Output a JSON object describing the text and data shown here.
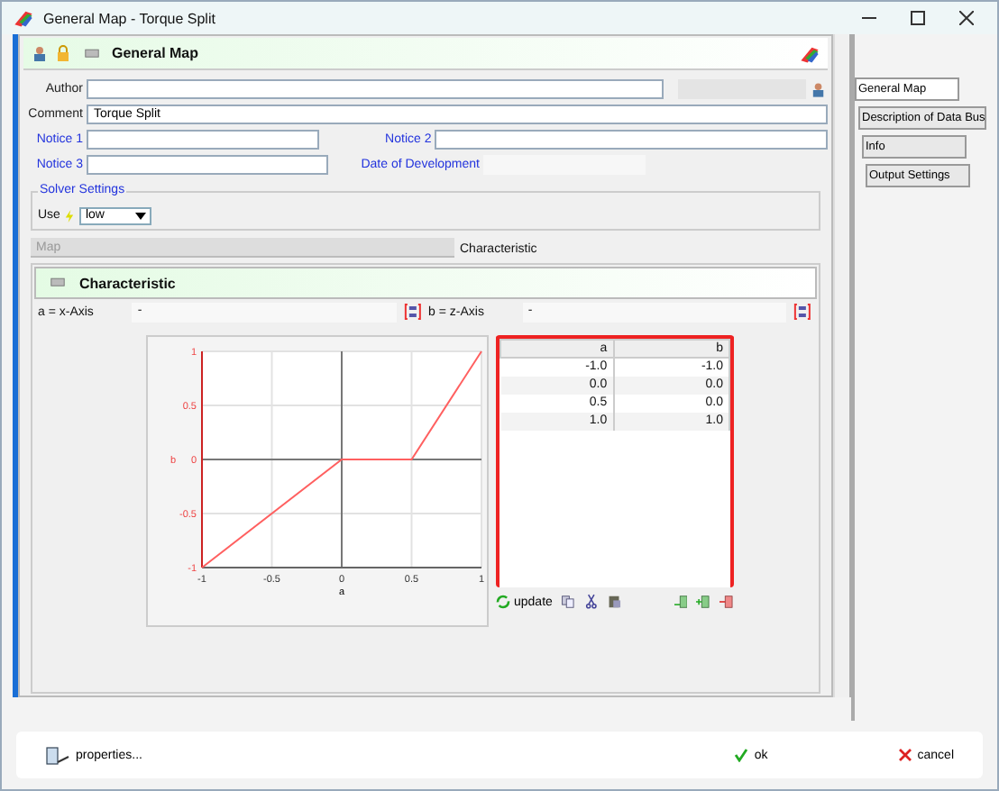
{
  "window": {
    "title": "General Map - Torque Split"
  },
  "header": {
    "title": "General Map"
  },
  "form": {
    "author": {
      "label": "Author"
    },
    "comment": {
      "label": "Comment",
      "value": "Torque Split"
    },
    "notice_1": {
      "label": "Notice 1"
    },
    "notice_2": {
      "label": "Notice 2"
    },
    "notice_3": {
      "label": "Notice 3"
    },
    "date_of_development": {
      "label": "Date of Development"
    }
  },
  "solver_settings": {
    "title": "Solver Settings",
    "use_label": "Use",
    "value": "low"
  },
  "tabs": [
    {
      "label": "Map",
      "selected": false
    },
    {
      "label": "Characteristic",
      "selected": true
    }
  ],
  "characteristic": {
    "title": "Characteristic",
    "axes": [
      {
        "label": "a = x-Axis",
        "value": "-"
      },
      {
        "label": "b = z-Axis",
        "value": "-"
      }
    ],
    "chart_data": {
      "type": "line",
      "xlabel": "a",
      "ylabel": "b",
      "x": [
        -1,
        0,
        0.5,
        1
      ],
      "series": [
        {
          "color": "#ff6060",
          "values": [
            -1,
            0,
            0,
            1
          ]
        }
      ],
      "grid": true,
      "xlim": [
        -1,
        1
      ],
      "ylim": [
        -1,
        1
      ],
      "xticks": [
        -1,
        -0.5,
        0,
        0.5,
        1
      ],
      "yticks": [
        -1,
        -0.5,
        0,
        0.5,
        1
      ]
    },
    "table": {
      "columns": [
        "a",
        "b"
      ],
      "rows": [
        [
          "-1.0",
          "-1.0"
        ],
        [
          "0.0",
          "0.0"
        ],
        [
          "0.5",
          "0.0"
        ],
        [
          "1.0",
          "1.0"
        ]
      ]
    },
    "update_label": "update"
  },
  "side_tabs": [
    {
      "label": "General Map",
      "selected": true
    },
    {
      "label": "Description of Data Bus",
      "selected": false
    },
    {
      "label": "Info",
      "selected": false
    },
    {
      "label": "Output Settings",
      "selected": false
    }
  ],
  "footer": {
    "properties": "properties...",
    "ok": "ok",
    "cancel": "cancel"
  }
}
